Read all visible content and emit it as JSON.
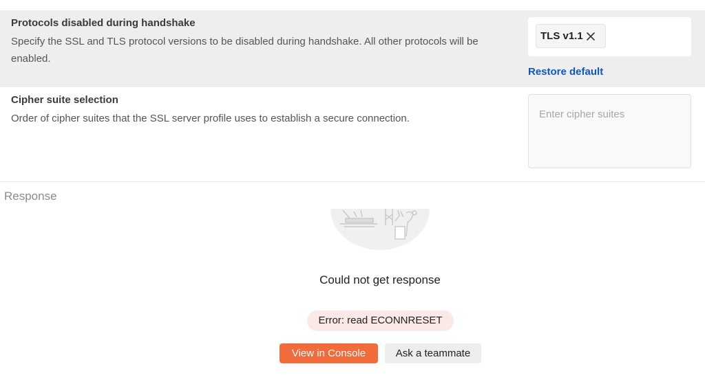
{
  "protocols": {
    "title": "Protocols disabled during handshake",
    "description": "Specify the SSL and TLS protocol versions to be disabled during handshake. All other protocols will be enabled.",
    "selected_chips": [
      "TLS v1.1"
    ],
    "restore_label": "Restore default"
  },
  "cipher": {
    "title": "Cipher suite selection",
    "description": "Order of cipher suites that the SSL server profile uses to establish a secure connection.",
    "placeholder": "Enter cipher suites",
    "value": ""
  },
  "response": {
    "label": "Response",
    "error_title": "Could not get response",
    "error_detail": "Error: read ECONNRESET",
    "console_button": "View in Console",
    "teammate_button": "Ask a teammate"
  },
  "colors": {
    "accent": "#f26b3a",
    "link": "#0b57c4",
    "error_badge_bg": "#fbe9e7",
    "row_highlight_bg": "#eeeeee"
  },
  "icons": {
    "chip_close": "close-icon",
    "illustration": "broken-connection-illustration"
  }
}
